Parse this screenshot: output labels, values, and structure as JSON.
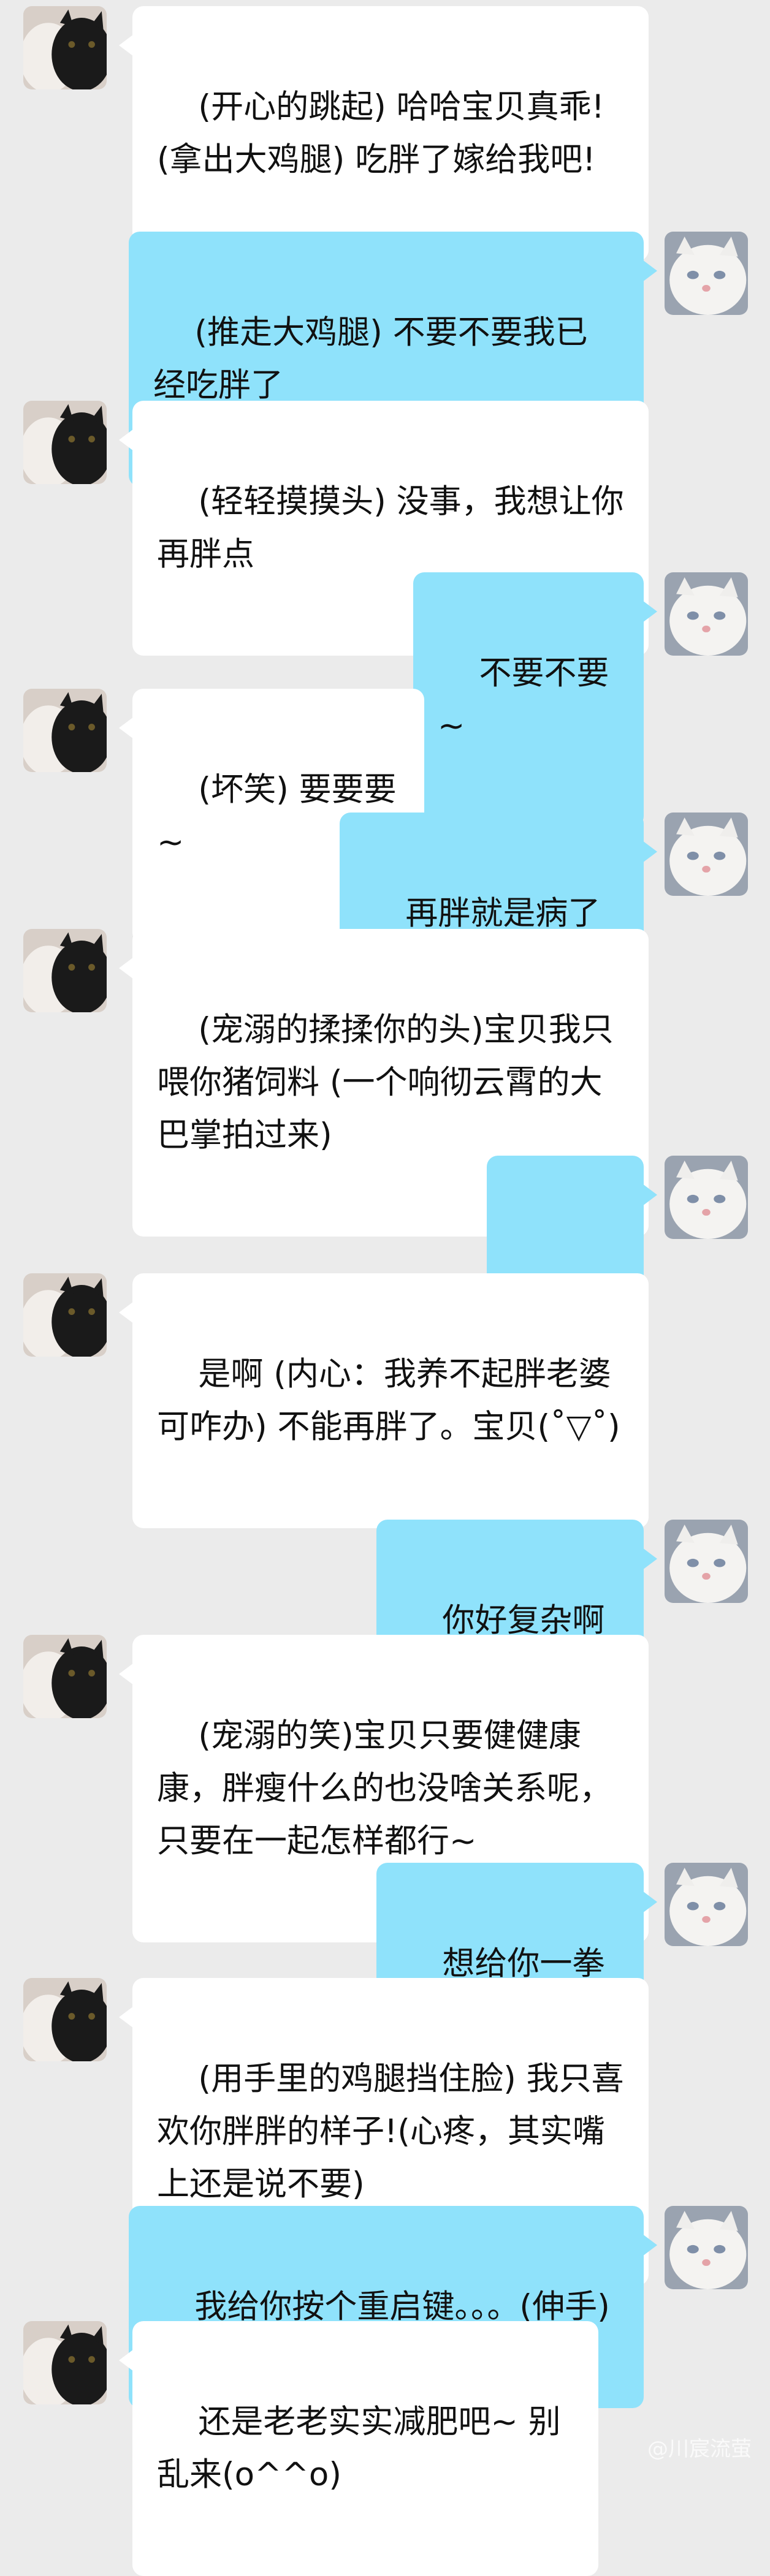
{
  "chat": {
    "messages": [
      {
        "side": "left",
        "avatar": "black-white-cat-avatar",
        "text": "(开心的跳起) 哈哈宝贝真乖!(拿出大鸡腿) 吃胖了嫁给我吧!"
      },
      {
        "side": "right",
        "avatar": "white-cat-avatar",
        "text": "(推走大鸡腿) 不要不要我已经吃胖了"
      },
      {
        "side": "left",
        "avatar": "black-white-cat-avatar",
        "text": "(轻轻摸摸头) 没事，我想让你再胖点"
      },
      {
        "side": "right",
        "avatar": "white-cat-avatar",
        "text": "不要不要 ~"
      },
      {
        "side": "left",
        "avatar": "black-white-cat-avatar",
        "text": "(坏笑) 要要要~"
      },
      {
        "side": "right",
        "avatar": "white-cat-avatar",
        "text": "再胖就是病了 ~"
      },
      {
        "side": "left",
        "avatar": "black-white-cat-avatar",
        "text": "(宠溺的揉揉你的头)宝贝我只喂你猪饲料 (一个响彻云霄的大巴掌拍过来)"
      },
      {
        "side": "right",
        "avatar": "white-cat-avatar",
        "text": "？？？"
      },
      {
        "side": "left",
        "avatar": "black-white-cat-avatar",
        "text": "是啊 (内心：我养不起胖老婆可咋办) 不能再胖了。宝贝(˚▽˚)"
      },
      {
        "side": "right",
        "avatar": "white-cat-avatar",
        "text": "你好复杂啊 ~"
      },
      {
        "side": "left",
        "avatar": "black-white-cat-avatar",
        "text": "(宠溺的笑)宝贝只要健健康康，胖瘦什么的也没啥关系呢，只要在一起怎样都行~"
      },
      {
        "side": "right",
        "avatar": "white-cat-avatar",
        "text": "想给你一拳 ~"
      },
      {
        "side": "left",
        "avatar": "black-white-cat-avatar",
        "text": "(用手里的鸡腿挡住脸) 我只喜欢你胖胖的样子!(心疼，其实嘴上还是说不要)"
      },
      {
        "side": "right",
        "avatar": "white-cat-avatar",
        "text": "我给你按个重启键。。。(伸手)"
      },
      {
        "side": "left",
        "avatar": "black-white-cat-avatar",
        "text": "还是老老实实减肥吧~ 别乱来(o^^o)"
      }
    ]
  },
  "watermark": "@川宸流萤",
  "colors": {
    "background": "#ebebeb",
    "incoming_bubble": "#ffffff",
    "outgoing_bubble": "#8fe2fb"
  }
}
